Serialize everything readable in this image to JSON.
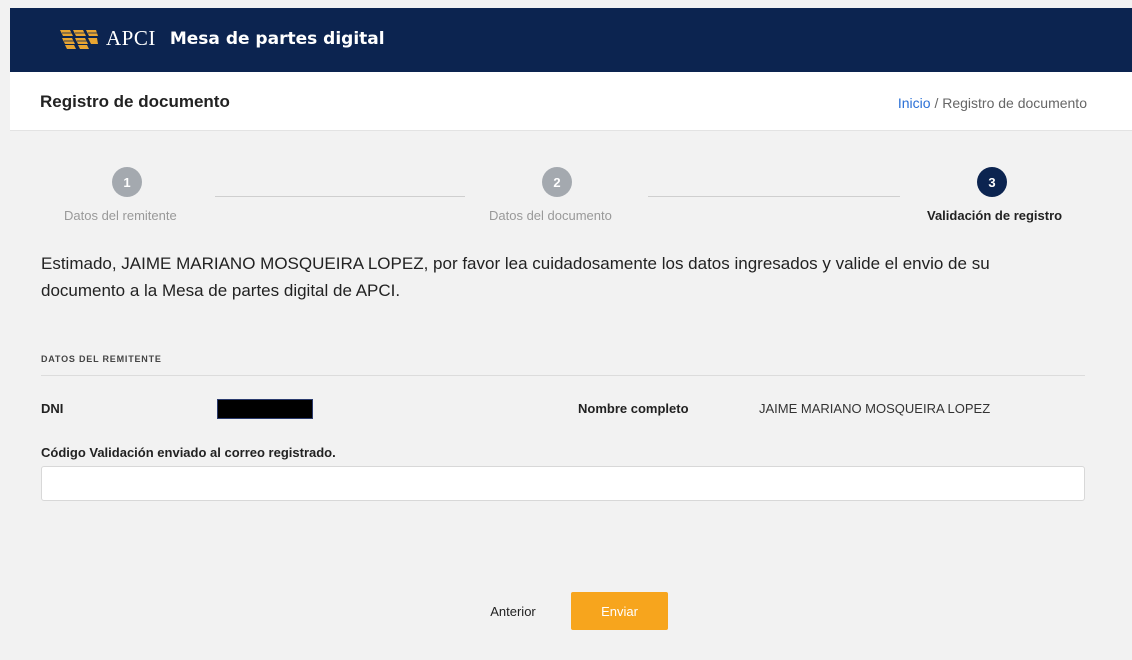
{
  "header": {
    "brand": "APCI",
    "app_title": "Mesa de partes digital",
    "bg_color": "#0c2450",
    "logo_color": "#e8a532"
  },
  "page": {
    "title": "Registro de documento",
    "breadcrumb": {
      "home": "Inicio",
      "separator": "/",
      "current": "Registro de documento"
    }
  },
  "stepper": {
    "steps": [
      {
        "number": "1",
        "label": "Datos del remitente",
        "state": "completed"
      },
      {
        "number": "2",
        "label": "Datos del documento",
        "state": "completed"
      },
      {
        "number": "3",
        "label": "Validación de registro",
        "state": "active"
      }
    ]
  },
  "intro_text": "Estimado, JAIME MARIANO MOSQUEIRA LOPEZ, por favor lea cuidadosamente los datos ingresados y valide el envio de su documento a la Mesa de partes digital de APCI.",
  "sender": {
    "section_title": "DATOS DEL REMITENTE",
    "dni_label": "DNI",
    "dni_value": "",
    "name_label": "Nombre completo",
    "name_value": "JAIME MARIANO MOSQUEIRA LOPEZ"
  },
  "validation": {
    "label": "Código Validación enviado al correo registrado.",
    "value": "",
    "placeholder": ""
  },
  "actions": {
    "prev_label": "Anterior",
    "send_label": "Enviar",
    "send_color": "#f7a51d"
  }
}
